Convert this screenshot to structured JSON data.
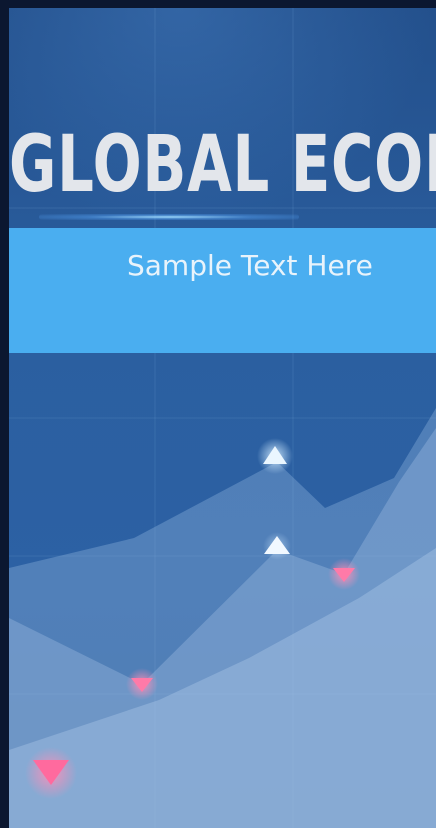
{
  "slide": {
    "title": "GLOBAL ECONO",
    "subtitle": "Sample Text Here"
  },
  "colors": {
    "background": "#2b5fa0",
    "band": "#4aaef0",
    "title": "#e3e6eb",
    "marker_up": "#e9f4fb",
    "marker_down": "#ff6fa0"
  },
  "icons": [
    "triangle-up-icon",
    "triangle-down-icon"
  ]
}
